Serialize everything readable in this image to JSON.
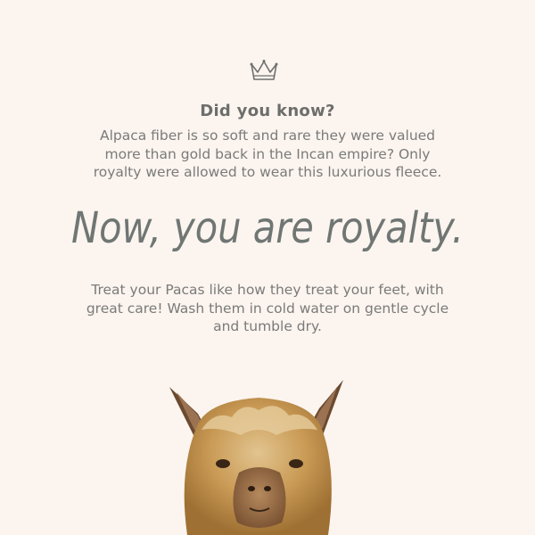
{
  "header": {
    "icon": "crown-icon",
    "eyebrow": "Did you know?"
  },
  "fact": {
    "text": "Alpaca fiber is so soft and rare they were valued more than gold back in the Incan empire? Only royalty were allowed to wear this luxurious fleece."
  },
  "headline": {
    "text": "Now, you are royalty."
  },
  "care": {
    "text": "Treat your Pacas like how they treat your feet, with great care! Wash them in cold water on gentle cycle and tumble dry."
  },
  "image": {
    "subject": "alpaca-image"
  },
  "colors": {
    "background": "#fcf4ef",
    "text": "#7a7b79",
    "headline": "#6f7673"
  }
}
